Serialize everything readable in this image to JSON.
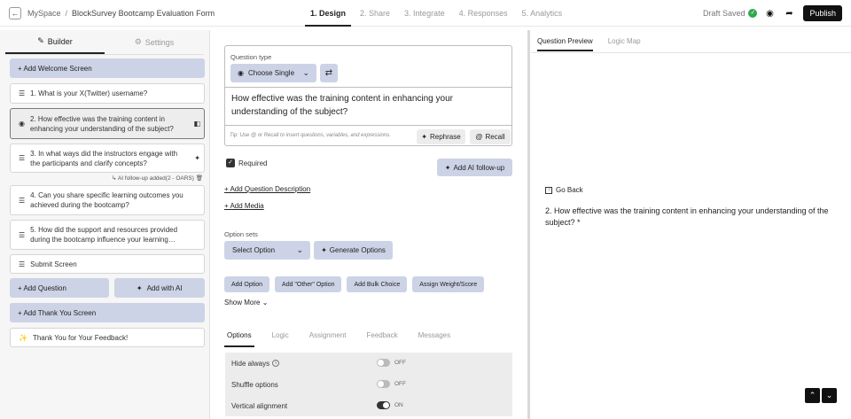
{
  "header": {
    "breadcrumb_root": "MySpace",
    "breadcrumb_sep": "/",
    "form_title": "BlockSurvey Bootcamp Evaluation Form",
    "steps": [
      "1. Design",
      "2. Share",
      "3. Integrate",
      "4. Responses",
      "5. Analytics"
    ],
    "status": "Draft Saved",
    "publish_label": "Publish"
  },
  "left_panel": {
    "tabs": {
      "builder": "Builder",
      "settings": "Settings"
    },
    "add_welcome": "+ Add Welcome Screen",
    "questions": [
      "1. What is your X(Twitter) username?",
      "2. How effective was the training content in enhancing your understanding of the subject?",
      "3. In what ways did the instructors engage with the participants and clarify concepts?",
      "4. Can you share specific learning outcomes you achieved during the bootcamp?",
      "5. How did the support and resources provided during the bootcamp influence your learning…"
    ],
    "followup_note": "AI follow-up added(2 - OARS)",
    "submit_screen": "Submit Screen",
    "add_question": "+ Add Question",
    "add_with_ai": "Add with AI",
    "add_thank_you": "+ Add Thank You Screen",
    "thank_you_item": "Thank You for Your Feedback!"
  },
  "editor": {
    "question_type_label": "Question type",
    "question_type_value": "Choose Single",
    "question_text": "How effective was the training content in enhancing your understanding of the subject?",
    "tip": "Tip: Use @ or Recall to insert questions, variables, and expressions.",
    "rephrase_label": "Rephrase",
    "recall_label": "Recall",
    "required_label": "Required",
    "ai_followup_label": "Add AI follow-up",
    "add_description": "+ Add Question Description",
    "add_media": "+ Add Media",
    "option_sets_label": "Option sets",
    "select_option": "Select Option",
    "generate_options": "Generate Options",
    "small_buttons": [
      "Add Option",
      "Add \"Other\" Option",
      "Add Bulk Choice",
      "Assign Weight/Score"
    ],
    "show_more": "Show More",
    "tabs": [
      "Options",
      "Logic",
      "Assignment",
      "Feedback",
      "Messages"
    ],
    "option_rows": [
      {
        "label": "Hide always",
        "state": "OFF",
        "on": false
      },
      {
        "label": "Shuffle options",
        "state": "OFF",
        "on": false
      },
      {
        "label": "Vertical alignment",
        "state": "ON",
        "on": true
      }
    ]
  },
  "preview": {
    "tabs": [
      "Question Preview",
      "Logic Map"
    ],
    "go_back": "Go Back",
    "question": "2. How effective was the training content in enhancing your understanding of the subject? *"
  },
  "colors": {
    "accent_button": "#cdd3e6",
    "publish": "#111111",
    "saved_check": "#2fa84f"
  }
}
